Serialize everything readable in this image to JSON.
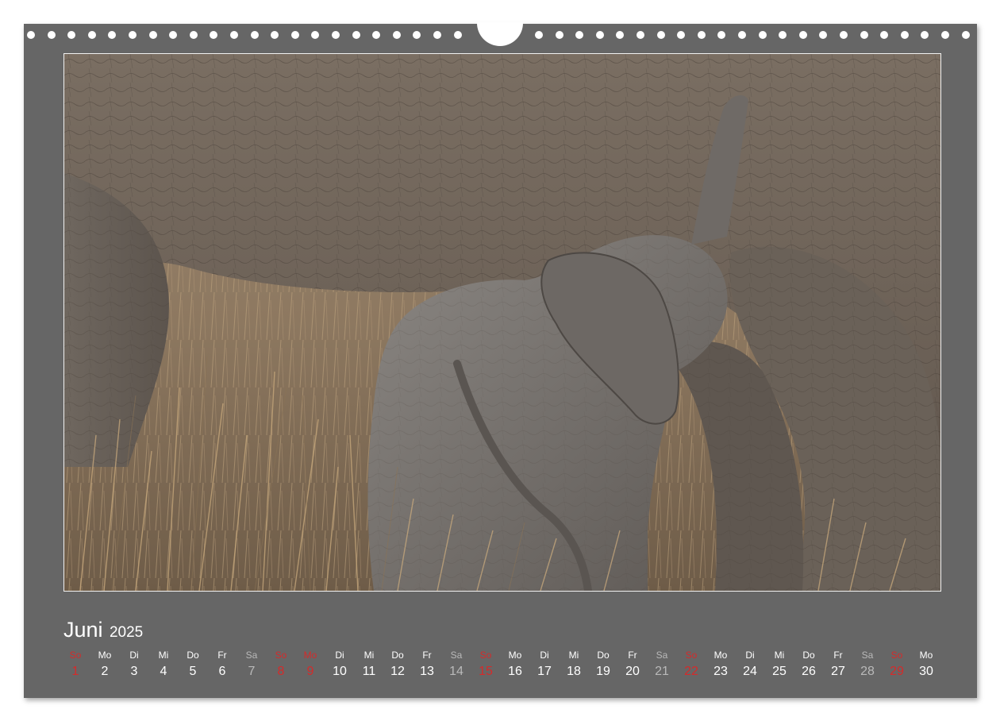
{
  "calendar": {
    "month": "Juni",
    "year": "2025",
    "colors": {
      "background": "#666666",
      "text": "#ffffff",
      "saturday": "#b9b9b9",
      "sunday_holiday": "#d42b2b"
    },
    "days": [
      {
        "wd": "So",
        "num": "1",
        "kind": "sun"
      },
      {
        "wd": "Mo",
        "num": "2",
        "kind": "wk"
      },
      {
        "wd": "Di",
        "num": "3",
        "kind": "wk"
      },
      {
        "wd": "Mi",
        "num": "4",
        "kind": "wk"
      },
      {
        "wd": "Do",
        "num": "5",
        "kind": "wk"
      },
      {
        "wd": "Fr",
        "num": "6",
        "kind": "wk"
      },
      {
        "wd": "Sa",
        "num": "7",
        "kind": "sat"
      },
      {
        "wd": "So",
        "num": "8",
        "kind": "sun"
      },
      {
        "wd": "Mo",
        "num": "9",
        "kind": "hol"
      },
      {
        "wd": "Di",
        "num": "10",
        "kind": "wk"
      },
      {
        "wd": "Mi",
        "num": "11",
        "kind": "wk"
      },
      {
        "wd": "Do",
        "num": "12",
        "kind": "wk"
      },
      {
        "wd": "Fr",
        "num": "13",
        "kind": "wk"
      },
      {
        "wd": "Sa",
        "num": "14",
        "kind": "sat"
      },
      {
        "wd": "So",
        "num": "15",
        "kind": "sun"
      },
      {
        "wd": "Mo",
        "num": "16",
        "kind": "wk"
      },
      {
        "wd": "Di",
        "num": "17",
        "kind": "wk"
      },
      {
        "wd": "Mi",
        "num": "18",
        "kind": "wk"
      },
      {
        "wd": "Do",
        "num": "19",
        "kind": "wk"
      },
      {
        "wd": "Fr",
        "num": "20",
        "kind": "wk"
      },
      {
        "wd": "Sa",
        "num": "21",
        "kind": "sat"
      },
      {
        "wd": "So",
        "num": "22",
        "kind": "sun"
      },
      {
        "wd": "Mo",
        "num": "23",
        "kind": "wk"
      },
      {
        "wd": "Di",
        "num": "24",
        "kind": "wk"
      },
      {
        "wd": "Mi",
        "num": "25",
        "kind": "wk"
      },
      {
        "wd": "Do",
        "num": "26",
        "kind": "wk"
      },
      {
        "wd": "Fr",
        "num": "27",
        "kind": "wk"
      },
      {
        "wd": "Sa",
        "num": "28",
        "kind": "sat"
      },
      {
        "wd": "So",
        "num": "29",
        "kind": "sun"
      },
      {
        "wd": "Mo",
        "num": "30",
        "kind": "wk"
      }
    ]
  }
}
